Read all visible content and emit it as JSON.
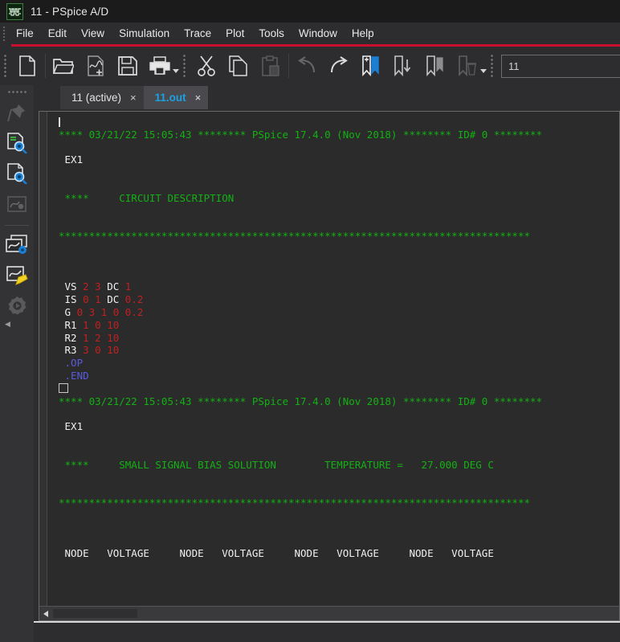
{
  "window": {
    "title": "11 - PSpice A/D",
    "app_icon": "pspice-waveform-icon"
  },
  "menubar": {
    "items": [
      {
        "label": "File",
        "name": "menu-file"
      },
      {
        "label": "Edit",
        "name": "menu-edit"
      },
      {
        "label": "View",
        "name": "menu-view"
      },
      {
        "label": "Simulation",
        "name": "menu-simulation"
      },
      {
        "label": "Trace",
        "name": "menu-trace"
      },
      {
        "label": "Plot",
        "name": "menu-plot"
      },
      {
        "label": "Tools",
        "name": "menu-tools"
      },
      {
        "label": "Window",
        "name": "menu-window"
      },
      {
        "label": "Help",
        "name": "menu-help"
      }
    ],
    "accent_color": "#c8102e"
  },
  "toolbar": {
    "buttons": [
      {
        "name": "new-file-icon",
        "tooltip": "New"
      },
      {
        "name": "open-folder-icon",
        "tooltip": "Open"
      },
      {
        "name": "add-trace-file-icon",
        "tooltip": "Append Waveform"
      },
      {
        "name": "save-icon",
        "tooltip": "Save"
      },
      {
        "name": "print-icon",
        "tooltip": "Print"
      },
      {
        "name": "cut-icon",
        "tooltip": "Cut"
      },
      {
        "name": "copy-icon",
        "tooltip": "Copy"
      },
      {
        "name": "paste-icon",
        "tooltip": "Paste"
      },
      {
        "name": "undo-icon",
        "tooltip": "Undo"
      },
      {
        "name": "redo-icon",
        "tooltip": "Redo"
      },
      {
        "name": "bookmark-toggle-icon",
        "tooltip": "Toggle Bookmark"
      },
      {
        "name": "bookmark-next-icon",
        "tooltip": "Next Bookmark"
      },
      {
        "name": "bookmark-previous-icon",
        "tooltip": "Previous Bookmark"
      },
      {
        "name": "bookmark-clear-icon",
        "tooltip": "Clear Bookmarks"
      }
    ],
    "search_value": "11",
    "search_placeholder": ""
  },
  "sidebar": {
    "items": [
      {
        "name": "pin-icon",
        "label": "Pin",
        "enabled": false
      },
      {
        "name": "output-file-search-icon",
        "label": "Output File",
        "enabled": true
      },
      {
        "name": "simulation-output-icon",
        "label": "Simulation Output",
        "enabled": true
      },
      {
        "name": "probe-cursor-icon",
        "label": "Probe Cursor",
        "enabled": false
      },
      {
        "name": "window-settings-icon",
        "label": "Window Settings",
        "enabled": true
      },
      {
        "name": "waveform-edit-icon",
        "label": "Edit Waveform",
        "enabled": true
      },
      {
        "name": "run-gear-icon",
        "label": "Run",
        "enabled": false
      }
    ],
    "collapse_label": "◀"
  },
  "tabs": [
    {
      "label": "11 (active)",
      "active": false,
      "close": "×",
      "name": "tab-11-active"
    },
    {
      "label": "11.out",
      "active": true,
      "close": "×",
      "name": "tab-11-out"
    }
  ],
  "output": {
    "lines": [
      {
        "type": "cursor"
      },
      {
        "type": "green",
        "text": "**** 03/21/22 15:05:43 ******** PSpice 17.4.0 (Nov 2018) ******** ID# 0 ********"
      },
      {
        "type": "blank"
      },
      {
        "type": "white",
        "text": " EX1"
      },
      {
        "type": "blank"
      },
      {
        "type": "blank"
      },
      {
        "type": "green",
        "text": " ****     CIRCUIT DESCRIPTION"
      },
      {
        "type": "blank"
      },
      {
        "type": "blank"
      },
      {
        "type": "green",
        "text": "******************************************************************************"
      },
      {
        "type": "blank"
      },
      {
        "type": "blank"
      },
      {
        "type": "blank"
      },
      {
        "type": "netlist",
        "name": "VS",
        "args": "2 3",
        "kw": "DC",
        "vals": "1"
      },
      {
        "type": "netlist",
        "name": "IS",
        "args": "0 1",
        "kw": "DC",
        "vals": "0.2"
      },
      {
        "type": "netlist",
        "name": "G",
        "args": "0 3 1 0 0.2",
        "kw": "",
        "vals": ""
      },
      {
        "type": "netlist",
        "name": "R1",
        "args": "1 0 10",
        "kw": "",
        "vals": ""
      },
      {
        "type": "netlist",
        "name": "R2",
        "args": "1 2 10",
        "kw": "",
        "vals": ""
      },
      {
        "type": "netlist",
        "name": "R3",
        "args": "3 0 10",
        "kw": "",
        "vals": ""
      },
      {
        "type": "directive",
        "text": ".OP"
      },
      {
        "type": "directive",
        "text": ".END"
      },
      {
        "type": "eof"
      },
      {
        "type": "green",
        "text": "**** 03/21/22 15:05:43 ******** PSpice 17.4.0 (Nov 2018) ******** ID# 0 ********"
      },
      {
        "type": "blank"
      },
      {
        "type": "white",
        "text": " EX1"
      },
      {
        "type": "blank"
      },
      {
        "type": "blank"
      },
      {
        "type": "green",
        "text": " ****     SMALL SIGNAL BIAS SOLUTION        TEMPERATURE =   27.000 DEG C"
      },
      {
        "type": "blank"
      },
      {
        "type": "blank"
      },
      {
        "type": "green",
        "text": "******************************************************************************"
      },
      {
        "type": "blank"
      },
      {
        "type": "blank"
      },
      {
        "type": "blank"
      },
      {
        "type": "white",
        "text": " NODE   VOLTAGE     NODE   VOLTAGE     NODE   VOLTAGE     NODE   VOLTAGE"
      }
    ],
    "colors": {
      "green": "#13b113",
      "white": "#f0f0f0",
      "red": "#c02020",
      "blue": "#5b5be0",
      "background": "#2b2b2b"
    }
  },
  "scrollbar": {
    "left_arrow": "◀"
  }
}
